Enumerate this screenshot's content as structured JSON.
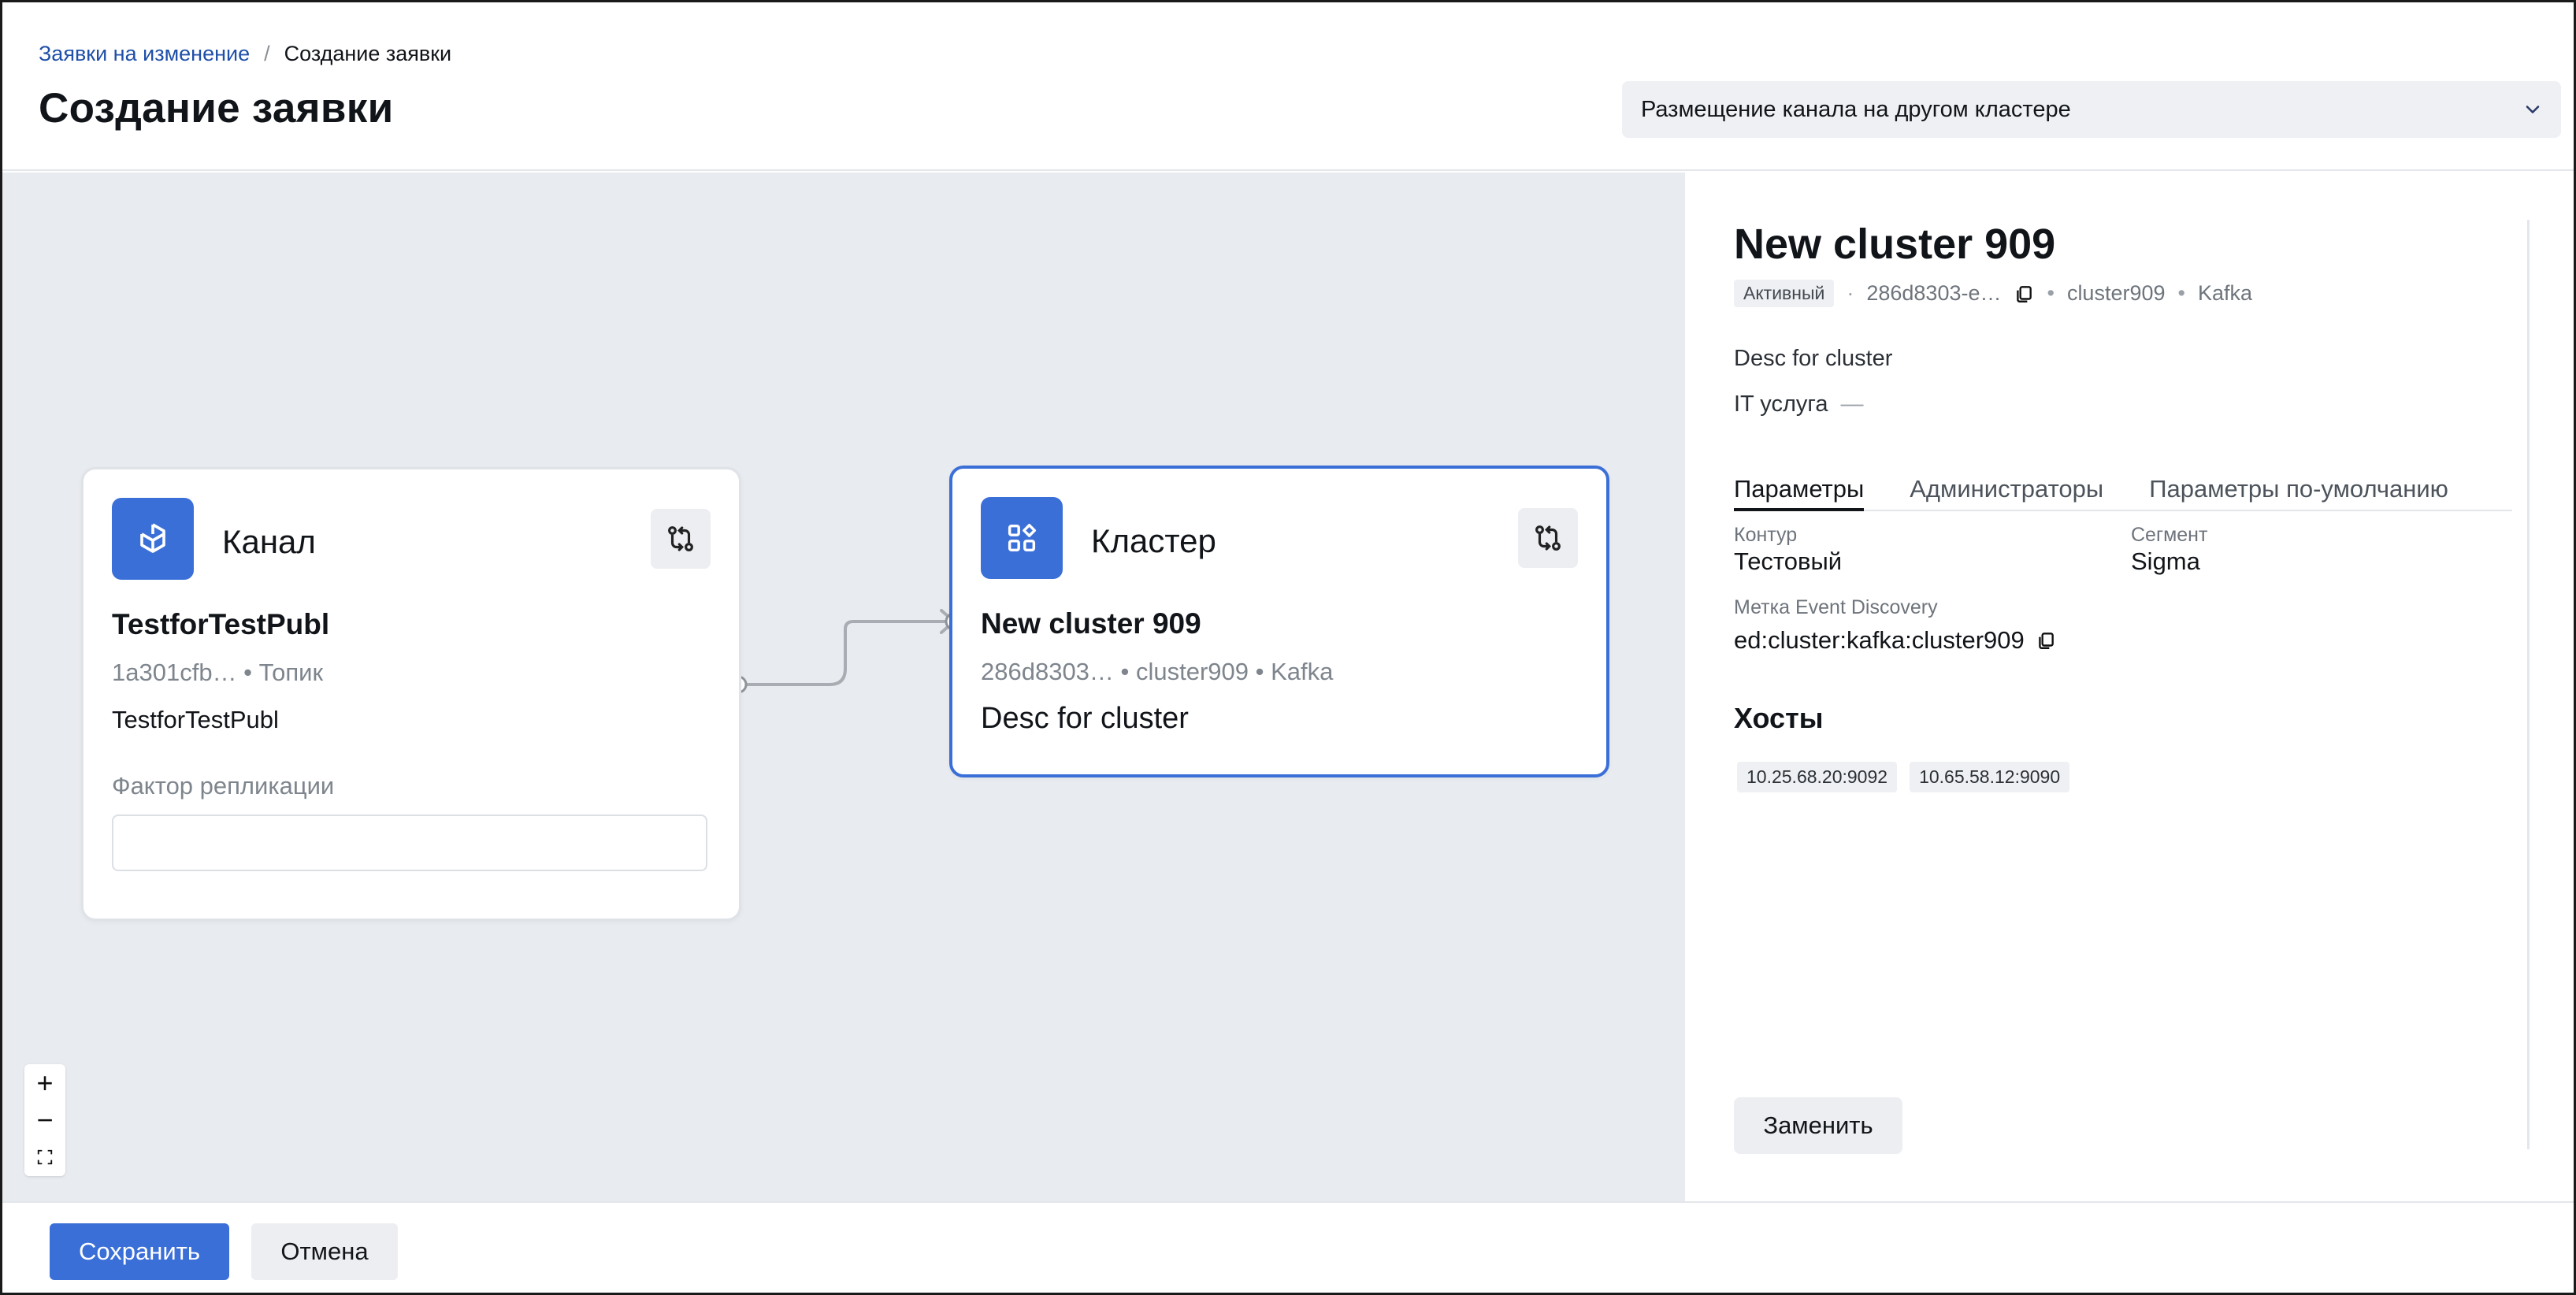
{
  "header": {
    "breadcrumb": {
      "parent": "Заявки на изменение",
      "separator": "/",
      "current": "Создание заявки"
    },
    "title": "Создание заявки",
    "request_type": {
      "selected": "Размещение канала на другом кластере",
      "icon": "chevron-down-icon"
    }
  },
  "canvas": {
    "channel_node": {
      "type_label": "Канал",
      "icon": "box-channel-icon",
      "name": "TestforTestPubl",
      "meta": "1a301cfb… • Топик",
      "description": "TestforTestPubl",
      "replication_label": "Фактор репликации",
      "replication_value": ""
    },
    "cluster_node": {
      "type_label": "Кластер",
      "icon": "apps-grid-icon",
      "name": "New cluster 909",
      "meta": "286d8303… • cluster909 • Kafka",
      "description": "Desc for cluster"
    },
    "zoom": {
      "in": "+",
      "out": "−",
      "fit": "⛶"
    }
  },
  "panel": {
    "title": "New cluster 909",
    "status": "Активный",
    "id_short": "286d8303-e…",
    "name": "cluster909",
    "engine": "Kafka",
    "description": "Desc for cluster",
    "it_service_label": "IT услуга",
    "it_service_value": "—",
    "tabs": [
      "Параметры",
      "Администраторы",
      "Параметры по-умолчанию"
    ],
    "active_tab": 0,
    "params": {
      "contour_label": "Контур",
      "contour_value": "Тестовый",
      "segment_label": "Сегмент",
      "segment_value": "Sigma",
      "ed_label": "Метка Event Discovery",
      "ed_value": "ed:cluster:kafka:cluster909"
    },
    "hosts_title": "Хосты",
    "hosts": [
      "10.25.68.20:9092",
      "10.65.58.12:9090"
    ],
    "replace_button": "Заменить"
  },
  "footer": {
    "save": "Сохранить",
    "cancel": "Отмена"
  },
  "colors": {
    "accent": "#3b6fd8",
    "canvas_bg": "#e8ebef",
    "link": "#1f4fa8"
  }
}
